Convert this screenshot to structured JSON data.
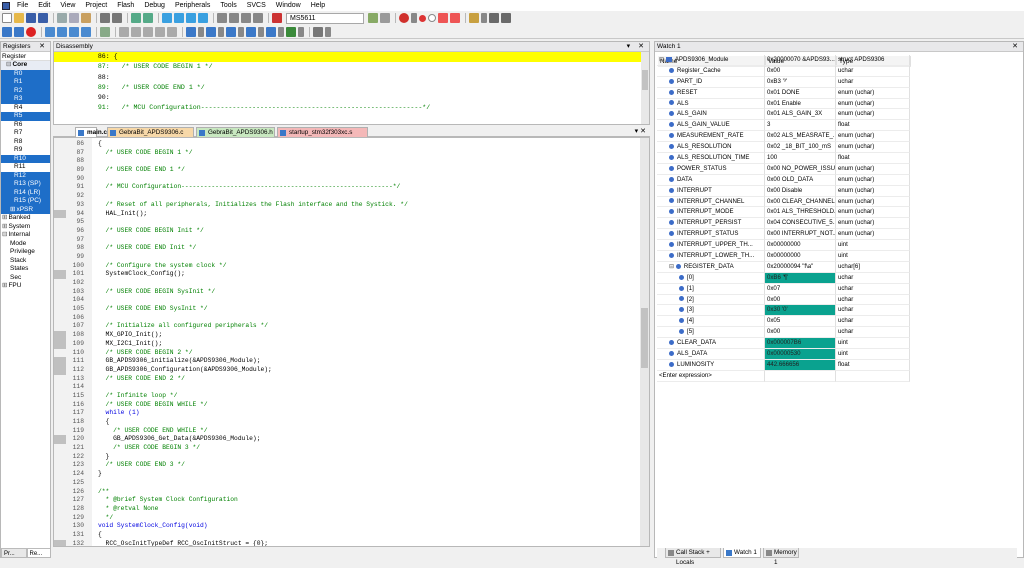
{
  "menu": [
    "File",
    "Edit",
    "View",
    "Project",
    "Flash",
    "Debug",
    "Peripherals",
    "Tools",
    "SVCS",
    "Window",
    "Help"
  ],
  "toolbar": {
    "target": "MS5611"
  },
  "registers": {
    "title": "Registers",
    "col": "Register",
    "rows": [
      {
        "label": "Core",
        "bold": true,
        "indent": 1,
        "sel": false,
        "exp": "⊟"
      },
      {
        "label": "R0",
        "indent": 3,
        "sel": true
      },
      {
        "label": "R1",
        "indent": 3,
        "sel": true
      },
      {
        "label": "R2",
        "indent": 3,
        "sel": true
      },
      {
        "label": "R3",
        "indent": 3,
        "sel": true
      },
      {
        "label": "R4",
        "indent": 3,
        "sel": false
      },
      {
        "label": "R5",
        "indent": 3,
        "sel": true
      },
      {
        "label": "R6",
        "indent": 3,
        "sel": false
      },
      {
        "label": "R7",
        "indent": 3,
        "sel": false
      },
      {
        "label": "R8",
        "indent": 3,
        "sel": false
      },
      {
        "label": "R9",
        "indent": 3,
        "sel": false
      },
      {
        "label": "R10",
        "indent": 3,
        "sel": true
      },
      {
        "label": "R11",
        "indent": 3,
        "sel": false
      },
      {
        "label": "R12",
        "indent": 3,
        "sel": true
      },
      {
        "label": "R13 (SP)",
        "indent": 3,
        "sel": true
      },
      {
        "label": "R14 (LR)",
        "indent": 3,
        "sel": true
      },
      {
        "label": "R15 (PC)",
        "indent": 3,
        "sel": true
      },
      {
        "label": "xPSR",
        "indent": 2,
        "sel": true,
        "exp": "⊞"
      },
      {
        "label": "Banked",
        "indent": 0,
        "sel": false,
        "exp": "⊞"
      },
      {
        "label": "System",
        "indent": 0,
        "sel": false,
        "exp": "⊞"
      },
      {
        "label": "Internal",
        "indent": 0,
        "sel": false,
        "exp": "⊟"
      },
      {
        "label": "Mode",
        "indent": 2,
        "sel": false
      },
      {
        "label": "Privilege",
        "indent": 2,
        "sel": false
      },
      {
        "label": "Stack",
        "indent": 2,
        "sel": false
      },
      {
        "label": "States",
        "indent": 2,
        "sel": false
      },
      {
        "label": "Sec",
        "indent": 2,
        "sel": false
      },
      {
        "label": "FPU",
        "indent": 0,
        "sel": false,
        "exp": "⊞"
      }
    ],
    "bottom_tabs": [
      "Pr...",
      "Re..."
    ]
  },
  "disassembly": {
    "title": "Disassembly",
    "lines": [
      {
        "text": "    86: {",
        "cm": false,
        "hl": true
      },
      {
        "text": "    87:   /* USER CODE BEGIN 1 */",
        "cm": true
      },
      {
        "text": "    88:",
        "cm": false
      },
      {
        "text": "    89:   /* USER CODE END 1 */",
        "cm": true
      },
      {
        "text": "    90:",
        "cm": false
      },
      {
        "text": "    91:   /* MCU Configuration--------------------------------------------------------*/",
        "cm": true
      }
    ]
  },
  "tabs": [
    "main.c",
    "GebraBit_APDS9306.c",
    "GebraBit_APDS9306.h",
    "startup_stm32f303xc.s"
  ],
  "code": [
    {
      "n": "86",
      "t": "{",
      "k": "n",
      "m": false
    },
    {
      "n": "87",
      "t": "  /* USER CODE BEGIN 1 */",
      "k": "c",
      "m": false
    },
    {
      "n": "88",
      "t": "",
      "k": "n",
      "m": false
    },
    {
      "n": "89",
      "t": "  /* USER CODE END 1 */",
      "k": "c",
      "m": false
    },
    {
      "n": "90",
      "t": "",
      "k": "n",
      "m": false
    },
    {
      "n": "91",
      "t": "  /* MCU Configuration--------------------------------------------------------*/",
      "k": "c",
      "m": false
    },
    {
      "n": "92",
      "t": "",
      "k": "n",
      "m": false
    },
    {
      "n": "93",
      "t": "  /* Reset of all peripherals, Initializes the Flash interface and the Systick. */",
      "k": "c",
      "m": false
    },
    {
      "n": "94",
      "t": "  HAL_Init();",
      "k": "n",
      "m": true
    },
    {
      "n": "95",
      "t": "",
      "k": "n",
      "m": false
    },
    {
      "n": "96",
      "t": "  /* USER CODE BEGIN Init */",
      "k": "c",
      "m": false
    },
    {
      "n": "97",
      "t": "",
      "k": "n",
      "m": false
    },
    {
      "n": "98",
      "t": "  /* USER CODE END Init */",
      "k": "c",
      "m": false
    },
    {
      "n": "99",
      "t": "",
      "k": "n",
      "m": false
    },
    {
      "n": "100",
      "t": "  /* Configure the system clock */",
      "k": "c",
      "m": false
    },
    {
      "n": "101",
      "t": "  SystemClock_Config();",
      "k": "n",
      "m": true
    },
    {
      "n": "102",
      "t": "",
      "k": "n",
      "m": false
    },
    {
      "n": "103",
      "t": "  /* USER CODE BEGIN SysInit */",
      "k": "c",
      "m": false
    },
    {
      "n": "104",
      "t": "",
      "k": "n",
      "m": false
    },
    {
      "n": "105",
      "t": "  /* USER CODE END SysInit */",
      "k": "c",
      "m": false
    },
    {
      "n": "106",
      "t": "",
      "k": "n",
      "m": false
    },
    {
      "n": "107",
      "t": "  /* Initialize all configured peripherals */",
      "k": "c",
      "m": false
    },
    {
      "n": "108",
      "t": "  MX_GPIO_Init();",
      "k": "n",
      "m": true
    },
    {
      "n": "109",
      "t": "  MX_I2C1_Init();",
      "k": "n",
      "m": true
    },
    {
      "n": "110",
      "t": "  /* USER CODE BEGIN 2 */",
      "k": "c",
      "m": false
    },
    {
      "n": "111",
      "t": "  GB_APDS9306_initialize(&APDS9306_Module);",
      "k": "n",
      "m": true
    },
    {
      "n": "112",
      "t": "  GB_APDS9306_Configuration(&APDS9306_Module);",
      "k": "n",
      "m": true
    },
    {
      "n": "113",
      "t": "  /* USER CODE END 2 */",
      "k": "c",
      "m": false
    },
    {
      "n": "114",
      "t": "",
      "k": "n",
      "m": false
    },
    {
      "n": "115",
      "t": "  /* Infinite loop */",
      "k": "c",
      "m": false
    },
    {
      "n": "116",
      "t": "  /* USER CODE BEGIN WHILE */",
      "k": "c",
      "m": false
    },
    {
      "n": "117",
      "t": "  while (1)",
      "k": "w",
      "m": false
    },
    {
      "n": "118",
      "t": "  {",
      "k": "n",
      "m": false
    },
    {
      "n": "119",
      "t": "    /* USER CODE END WHILE */",
      "k": "c",
      "m": false
    },
    {
      "n": "120",
      "t": "    GB_APDS9306_Get_Data(&APDS9306_Module);",
      "k": "n",
      "m": true
    },
    {
      "n": "121",
      "t": "    /* USER CODE BEGIN 3 */",
      "k": "c",
      "m": false
    },
    {
      "n": "122",
      "t": "  }",
      "k": "n",
      "m": false
    },
    {
      "n": "123",
      "t": "  /* USER CODE END 3 */",
      "k": "c",
      "m": false
    },
    {
      "n": "124",
      "t": "}",
      "k": "n",
      "m": false
    },
    {
      "n": "125",
      "t": "",
      "k": "n",
      "m": false
    },
    {
      "n": "126",
      "t": "/**",
      "k": "c",
      "m": false
    },
    {
      "n": "127",
      "t": "  * @brief System Clock Configuration",
      "k": "c",
      "m": false
    },
    {
      "n": "128",
      "t": "  * @retval None",
      "k": "c",
      "m": false
    },
    {
      "n": "129",
      "t": "  */",
      "k": "c",
      "m": false
    },
    {
      "n": "130",
      "t": "void SystemClock_Config(void)",
      "k": "v",
      "m": false
    },
    {
      "n": "131",
      "t": "{",
      "k": "n",
      "m": false
    },
    {
      "n": "132",
      "t": "  RCC_OscInitTypeDef RCC_OscInitStruct = {0};",
      "k": "n",
      "m": true
    }
  ],
  "watch": {
    "title": "Watch 1",
    "cols": [
      "Name",
      "Value",
      "Type"
    ],
    "rows": [
      {
        "name": "APDS9306_Module",
        "value": "0x20000070 &APDS93...",
        "type": "struct APDS9306",
        "lvl": 0,
        "exp": "⊟",
        "teal": false,
        "icon": "none"
      },
      {
        "name": "Register_Cache",
        "value": "0x00",
        "type": "uchar",
        "lvl": 1,
        "teal": false
      },
      {
        "name": "PART_ID",
        "value": "0xB3 '³'",
        "type": "uchar",
        "lvl": 1,
        "teal": false
      },
      {
        "name": "RESET",
        "value": "0x01 DONE",
        "type": "enum (uchar)",
        "lvl": 1,
        "teal": false
      },
      {
        "name": "ALS",
        "value": "0x01 Enable",
        "type": "enum (uchar)",
        "lvl": 1,
        "teal": false
      },
      {
        "name": "ALS_GAIN",
        "value": "0x01 ALS_GAIN_3X",
        "type": "enum (uchar)",
        "lvl": 1,
        "teal": false
      },
      {
        "name": "ALS_GAIN_VALUE",
        "value": "3",
        "type": "float",
        "lvl": 1,
        "teal": false
      },
      {
        "name": "MEASUREMENT_RATE",
        "value": "0x02 ALS_MEASRATE_...",
        "type": "enum (uchar)",
        "lvl": 1,
        "teal": false
      },
      {
        "name": "ALS_RESOLUTION",
        "value": "0x02 _18_BIT_100_mS",
        "type": "enum (uchar)",
        "lvl": 1,
        "teal": false
      },
      {
        "name": "ALS_RESOLUTION_TIME",
        "value": "100",
        "type": "float",
        "lvl": 1,
        "teal": false
      },
      {
        "name": "POWER_STATUS",
        "value": "0x00 NO_POWER_ISSUE",
        "type": "enum (uchar)",
        "lvl": 1,
        "teal": false
      },
      {
        "name": "DATA",
        "value": "0x00 OLD_DATA",
        "type": "enum (uchar)",
        "lvl": 1,
        "teal": false
      },
      {
        "name": "INTERRUPT",
        "value": "0x00 Disable",
        "type": "enum (uchar)",
        "lvl": 1,
        "teal": false
      },
      {
        "name": "INTERRUPT_CHANNEL",
        "value": "0x00 CLEAR_CHANNEL",
        "type": "enum (uchar)",
        "lvl": 1,
        "teal": false
      },
      {
        "name": "INTERRUPT_MODE",
        "value": "0x01 ALS_THRESHOLD...",
        "type": "enum (uchar)",
        "lvl": 1,
        "teal": false
      },
      {
        "name": "INTERRUPT_PERSIST",
        "value": "0x04 CONSECUTIVE_5...",
        "type": "enum (uchar)",
        "lvl": 1,
        "teal": false
      },
      {
        "name": "INTERRUPT_STATUS",
        "value": "0x00 INTERRUPT_NOT...",
        "type": "enum (uchar)",
        "lvl": 1,
        "teal": false
      },
      {
        "name": "INTERRUPT_UPPER_TH...",
        "value": "0x00000000",
        "type": "uint",
        "lvl": 1,
        "teal": false
      },
      {
        "name": "INTERRUPT_LOWER_TH...",
        "value": "0x00000000",
        "type": "uint",
        "lvl": 1,
        "teal": false
      },
      {
        "name": "REGISTER_DATA",
        "value": "0x20000094 \"f\\a\"",
        "type": "uchar[6]",
        "lvl": 1,
        "exp": "⊟",
        "teal": false
      },
      {
        "name": "[0]",
        "value": "0xB6 '¶'",
        "type": "uchar",
        "lvl": 2,
        "teal": true
      },
      {
        "name": "[1]",
        "value": "0x07",
        "type": "uchar",
        "lvl": 2,
        "teal": false
      },
      {
        "name": "[2]",
        "value": "0x00",
        "type": "uchar",
        "lvl": 2,
        "teal": false
      },
      {
        "name": "[3]",
        "value": "0x30 '0'",
        "type": "uchar",
        "lvl": 2,
        "teal": true
      },
      {
        "name": "[4]",
        "value": "0x05",
        "type": "uchar",
        "lvl": 2,
        "teal": false
      },
      {
        "name": "[5]",
        "value": "0x00",
        "type": "uchar",
        "lvl": 2,
        "teal": false
      },
      {
        "name": "CLEAR_DATA",
        "value": "0x000007B6",
        "type": "uint",
        "lvl": 1,
        "teal": true
      },
      {
        "name": "ALS_DATA",
        "value": "0x00000530",
        "type": "uint",
        "lvl": 1,
        "teal": true
      },
      {
        "name": "LUMINOSITY",
        "value": "442.666656",
        "type": "float",
        "lvl": 1,
        "teal": true
      },
      {
        "name": "<Enter expression>",
        "value": "",
        "type": "",
        "lvl": 0,
        "teal": false,
        "icon": "none"
      }
    ],
    "bottom_tabs": [
      "Call Stack + Locals",
      "Watch 1",
      "Memory 1"
    ]
  }
}
